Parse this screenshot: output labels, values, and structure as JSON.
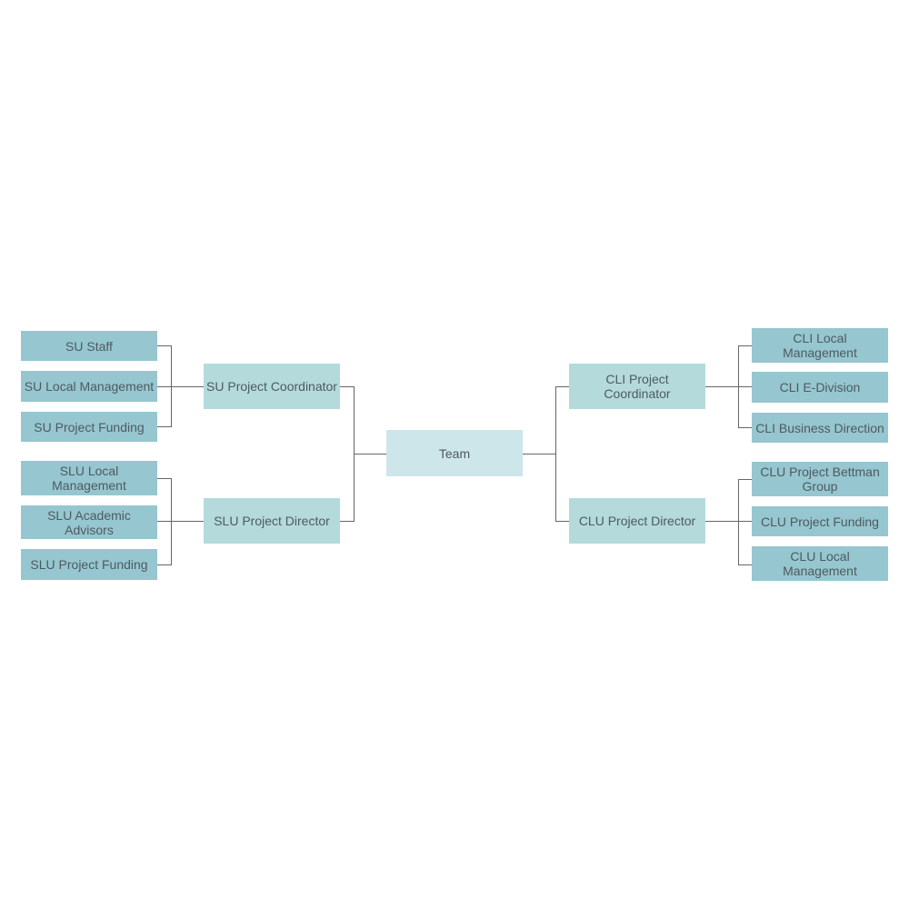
{
  "root": "Team",
  "left": {
    "su_coordinator": "SU Project Coordinator",
    "su_children": [
      "SU Staff",
      "SU Local Management",
      "SU Project Funding"
    ],
    "slu_director": "SLU Project Director",
    "slu_children": [
      "SLU Local Management",
      "SLU Academic Advisors",
      "SLU Project Funding"
    ]
  },
  "right": {
    "cli_coordinator": "CLI Project Coordinator",
    "cli_children": [
      "CLI Local Management",
      "CLI E-Division",
      "CLI Business Direction"
    ],
    "clu_director": "CLU Project Director",
    "clu_children": [
      "CLU Project Bettman Group",
      "CLU Project Funding",
      "CLU Local Management"
    ]
  },
  "colors": {
    "leaf": "#96c6d0",
    "mid": "#b4dadb",
    "root": "#cde6e9",
    "connector": "#555555"
  }
}
